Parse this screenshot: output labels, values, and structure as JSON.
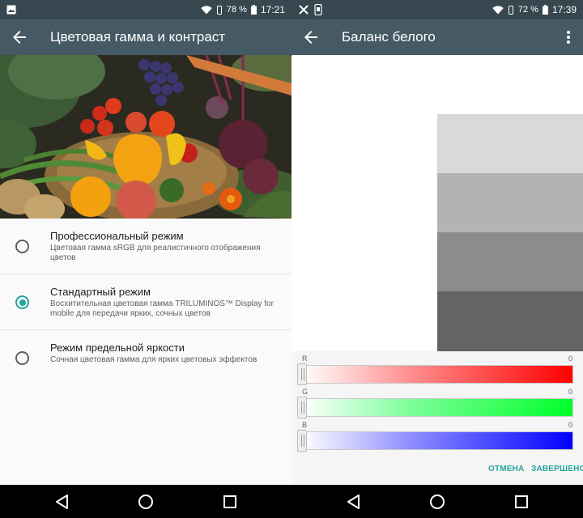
{
  "left_screen": {
    "status": {
      "battery": "78 %",
      "time": "17:21"
    },
    "title": "Цветовая гамма и контраст",
    "options": [
      {
        "title": "Профессиональный режим",
        "description": "Цветовая гамма sRGB для реалистичного отображения цветов",
        "selected": false
      },
      {
        "title": "Стандартный режим",
        "description": "Восхитительная цветовая гамма TRILUMINOS™ Display for mobile для передачи ярких, сочных цветов",
        "selected": true
      },
      {
        "title": "Режим предельной яркости",
        "description": "Сочная цветовая гамма для ярких цветовых эффектов",
        "selected": false
      }
    ]
  },
  "right_screen": {
    "status": {
      "battery": "72 %",
      "time": "17:39"
    },
    "title": "Баланс белого",
    "sliders": [
      {
        "label": "R",
        "value": "0",
        "color": "#ff0000"
      },
      {
        "label": "G",
        "value": "0",
        "color": "#00ff2a"
      },
      {
        "label": "B",
        "value": "0",
        "color": "#0000ff"
      }
    ],
    "cancel_label": "ОТМЕНА",
    "done_label": "ЗАВЕРШЕНО"
  },
  "colors": {
    "status_bar": "#37474f",
    "app_bar": "#455a64",
    "accent": "#26a69a"
  },
  "icons": {
    "back": "arrow-left-icon",
    "menu": "more-vert-icon",
    "wifi": "wifi-icon",
    "battery": "battery-icon",
    "nav": [
      "nav-back-icon",
      "nav-home-icon",
      "nav-recent-icon"
    ]
  }
}
